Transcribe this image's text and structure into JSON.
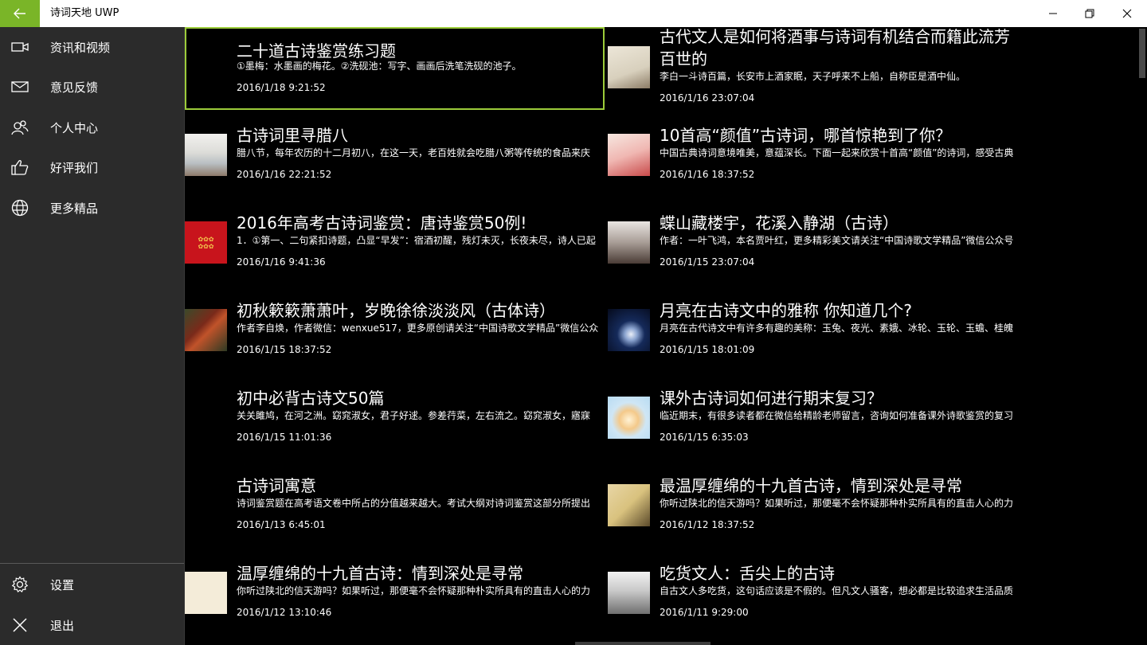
{
  "app": {
    "title": "诗词天地 UWP"
  },
  "colors": {
    "accent": "#7ab528",
    "selection": "#9ccc3a",
    "sidebar": "#2b2b2b",
    "background": "#000000"
  },
  "sidebar": {
    "items": [
      {
        "label": "资讯和视频",
        "icon": "video-camera-icon"
      },
      {
        "label": "意见反馈",
        "icon": "mail-icon"
      },
      {
        "label": "个人中心",
        "icon": "people-icon"
      },
      {
        "label": "好评我们",
        "icon": "thumbs-up-icon"
      },
      {
        "label": "更多精品",
        "icon": "globe-icon"
      }
    ],
    "bottom": [
      {
        "label": "设置",
        "icon": "gear-icon"
      },
      {
        "label": "退出",
        "icon": "close-icon"
      }
    ]
  },
  "articles": {
    "left": [
      {
        "title": "二十道古诗鉴赏练习题",
        "desc": "①墨梅：水墨画的梅花。②洗砚池：写字、画画后洗笔洗砚的池子。",
        "date": "2016/1/18 9:21:52",
        "thumb": "none"
      },
      {
        "title": "古诗词里寻腊八",
        "desc": "腊八节，每年农历的十二月初八，在这一天，老百姓就会吃腊八粥等传统的食品来庆",
        "date": "2016/1/16 22:21:52",
        "thumb": "landscape"
      },
      {
        "title": "2016年高考古诗词鉴赏：唐诗鉴赏50例!",
        "desc": "1．①第一、二句紧扣诗题，凸显“早发”：宿酒初醒，残灯未灭，长夜未尽，诗人已起",
        "date": "2016/1/16 9:41:36",
        "thumb": "red-poster"
      },
      {
        "title": "初秋簌簌萧萧叶，岁晚徐徐淡淡风（古体诗）",
        "desc": "作者李自焕，作者微信：wenxue517，更多原创请关注“中国诗歌文学精品”微信公众",
        "date": "2016/1/15 18:37:52",
        "thumb": "autumn"
      },
      {
        "title": "初中必背古诗文50篇",
        "desc": "关关雎鸠，在河之洲。窈窕淑女，君子好逑。参差荇菜，左右流之。窈窕淑女，寤寐",
        "date": "2016/1/15 11:01:36",
        "thumb": "none"
      },
      {
        "title": "古诗词寓意",
        "desc": "诗词鉴赏题在高考语文卷中所占的分值越来越大。考试大纲对诗词鉴赏这部分所提出",
        "date": "2016/1/13 6:45:01",
        "thumb": "none"
      },
      {
        "title": "温厚缠绵的十九首古诗：情到深处是寻常",
        "desc": "你听过陕北的信天游吗？如果听过，那便毫不会怀疑那种朴实所具有的直击人心的力",
        "date": "2016/1/12 13:10:46",
        "thumb": "cream"
      }
    ],
    "right": [
      {
        "title": "古代文人是如何将酒事与诗词有机结合而籍此流芳百世的",
        "desc": "李白一斗诗百篇，长安市上酒家眠，天子呼来不上船，自称臣是酒中仙。",
        "date": "2016/1/16 23:07:04",
        "thumb": "ink-figure"
      },
      {
        "title": "10首高“颜值”古诗词，哪首惊艳到了你？",
        "desc": "中国古典诗词意境唯美，意蕴深长。下面一起来欣赏十首高“颜值”的诗词，感受古典",
        "date": "2016/1/16 18:37:52",
        "thumb": "pink-lady"
      },
      {
        "title": "蝶山藏楼宇，花溪入静湖（古诗）",
        "desc": "作者：一叶飞鸿，本名贾叶红，更多精彩美文请关注“中国诗歌文学精品”微信公众号",
        "date": "2016/1/15 23:07:04",
        "thumb": "snow-tree"
      },
      {
        "title": "月亮在古诗文中的雅称 你知道几个?",
        "desc": "月亮在古代诗文中有许多有趣的美称：玉兔、夜光、素娥、冰轮、玉轮、玉蟾、桂魄",
        "date": "2016/1/15 18:01:09",
        "thumb": "moon"
      },
      {
        "title": "课外古诗词如何进行期末复习？",
        "desc": "临近期末，有很多读者都在微信给精龄老师留言，咨询如何准备课外诗歌鉴赏的复习",
        "date": "2016/1/15 6:35:03",
        "thumb": "cartoon"
      },
      {
        "title": "最温厚缠绵的十九首古诗，情到深处是寻常",
        "desc": "你听过陕北的信天游吗？如果听过，那便毫不会怀疑那种朴实所具有的直击人心的力",
        "date": "2016/1/12 18:37:52",
        "thumb": "bamboo"
      },
      {
        "title": "吃货文人：舌尖上的古诗",
        "desc": "自古文人多吃货，这句话应该是不假的。但凡文人骚客，想必都是比较追求生活品质",
        "date": "2016/1/11 9:29:00",
        "thumb": "ink-landscape"
      }
    ]
  }
}
